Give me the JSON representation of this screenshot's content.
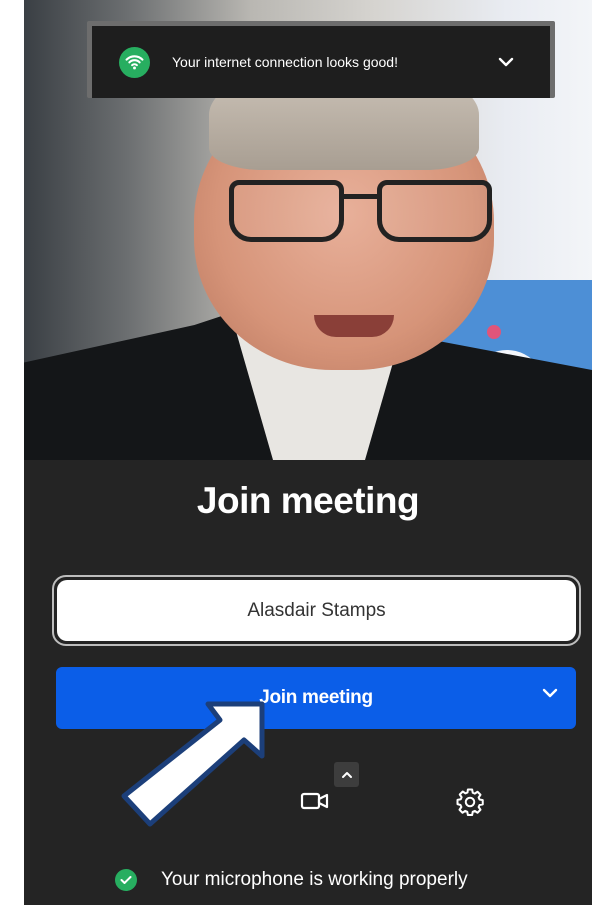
{
  "toast": {
    "message": "Your internet connection looks good!",
    "icon": "wifi-icon",
    "status_color": "#27ae60"
  },
  "panel": {
    "title": "Join meeting",
    "name_value": "Alasdair Stamps",
    "join_button_label": "Join meeting",
    "accent_color": "#0b5ee8"
  },
  "controls": {
    "camera_icon": "video-camera-icon",
    "settings_icon": "gear-icon",
    "options_icon": "chevron-up-icon"
  },
  "status": {
    "microphone_message": "Your microphone is working properly",
    "icon": "check-circle-icon"
  },
  "annotation": {
    "icon": "arrow-icon",
    "color": "#ffffff"
  }
}
